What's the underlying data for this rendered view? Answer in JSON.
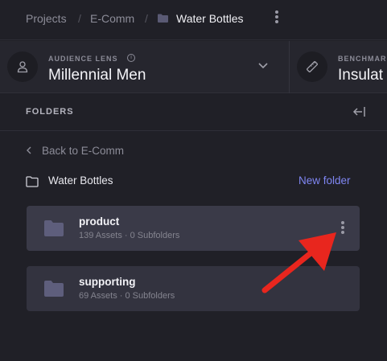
{
  "breadcrumbs": [
    {
      "label": "Projects"
    },
    {
      "label": "E-Comm"
    },
    {
      "label": "Water Bottles"
    }
  ],
  "breadcrumb_separator": "/",
  "audience_lens": {
    "label": "AUDIENCE LENS",
    "info": "i",
    "value": "Millennial Men"
  },
  "benchmark": {
    "label": "BENCHMARK",
    "value": "Insulat"
  },
  "folders_panel": {
    "title": "FOLDERS",
    "back_link": "Back to E-Comm",
    "current_folder": "Water Bottles",
    "new_folder": "New folder",
    "folders": [
      {
        "name": "product",
        "meta": "139 Assets · 0 Subfolders",
        "highlighted": true
      },
      {
        "name": "supporting",
        "meta": "69 Assets · 0 Subfolders",
        "highlighted": false
      }
    ]
  },
  "annotation": {
    "arrow_color": "#e8261e",
    "points_to": "product folder menu"
  },
  "colors": {
    "background": "#202027",
    "accent": "#7f86f2",
    "card": "#33333f"
  }
}
